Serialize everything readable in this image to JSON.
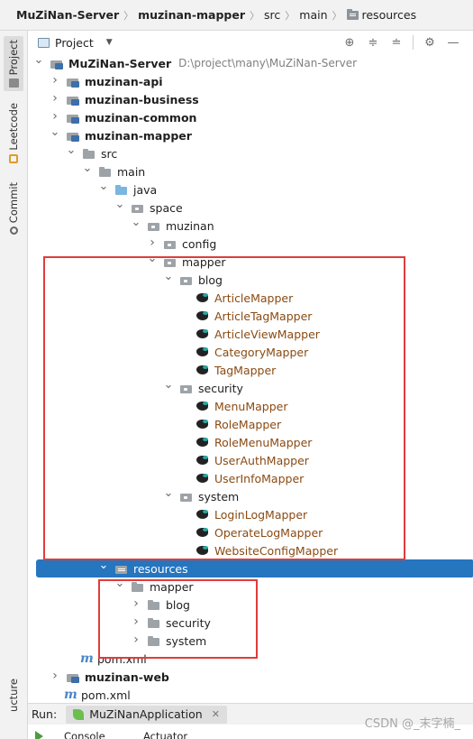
{
  "breadcrumb": {
    "items": [
      "MuZiNan-Server",
      "muzinan-mapper",
      "src",
      "main",
      "resources"
    ]
  },
  "left_strip": {
    "project_tab": "Project",
    "leetcode_tab": "Leetcode",
    "commit_tab": "Commit",
    "structure_tab": "ucture"
  },
  "panel": {
    "title": "Project",
    "icons": [
      "target-icon",
      "expand-all-icon",
      "collapse-all-icon",
      "gear-icon",
      "minimize-icon"
    ]
  },
  "tree": {
    "root": {
      "label": "MuZiNan-Server",
      "path": "D:\\project\\many\\MuZiNan-Server"
    },
    "api": "muzinan-api",
    "business": "muzinan-business",
    "common": "muzinan-common",
    "mapper_module": "muzinan-mapper",
    "src": "src",
    "main": "main",
    "java": "java",
    "space": "space",
    "muzinan": "muzinan",
    "config": "config",
    "mapper_pkg": "mapper",
    "blog": "blog",
    "blog_files": [
      "ArticleMapper",
      "ArticleTagMapper",
      "ArticleViewMapper",
      "CategoryMapper",
      "TagMapper"
    ],
    "security": "security",
    "security_files": [
      "MenuMapper",
      "RoleMapper",
      "RoleMenuMapper",
      "UserAuthMapper",
      "UserInfoMapper"
    ],
    "system": "system",
    "system_files": [
      "LoginLogMapper",
      "OperateLogMapper",
      "WebsiteConfigMapper"
    ],
    "resources": "resources",
    "res_mapper": "mapper",
    "res_blog": "blog",
    "res_security": "security",
    "res_system": "system",
    "module_pom": "pom.xml",
    "web": "muzinan-web",
    "root_pom": "pom.xml"
  },
  "run_bar": {
    "label": "Run:",
    "app": "MuZiNanApplication",
    "tab_console": "Console",
    "tab_actuator": "Actuator"
  },
  "watermark": "CSDN @_末字楠_",
  "colors": {
    "selection": "#2675bf",
    "highlight_box": "#e03c3c",
    "mapper_file_text": "#8a4a12"
  }
}
